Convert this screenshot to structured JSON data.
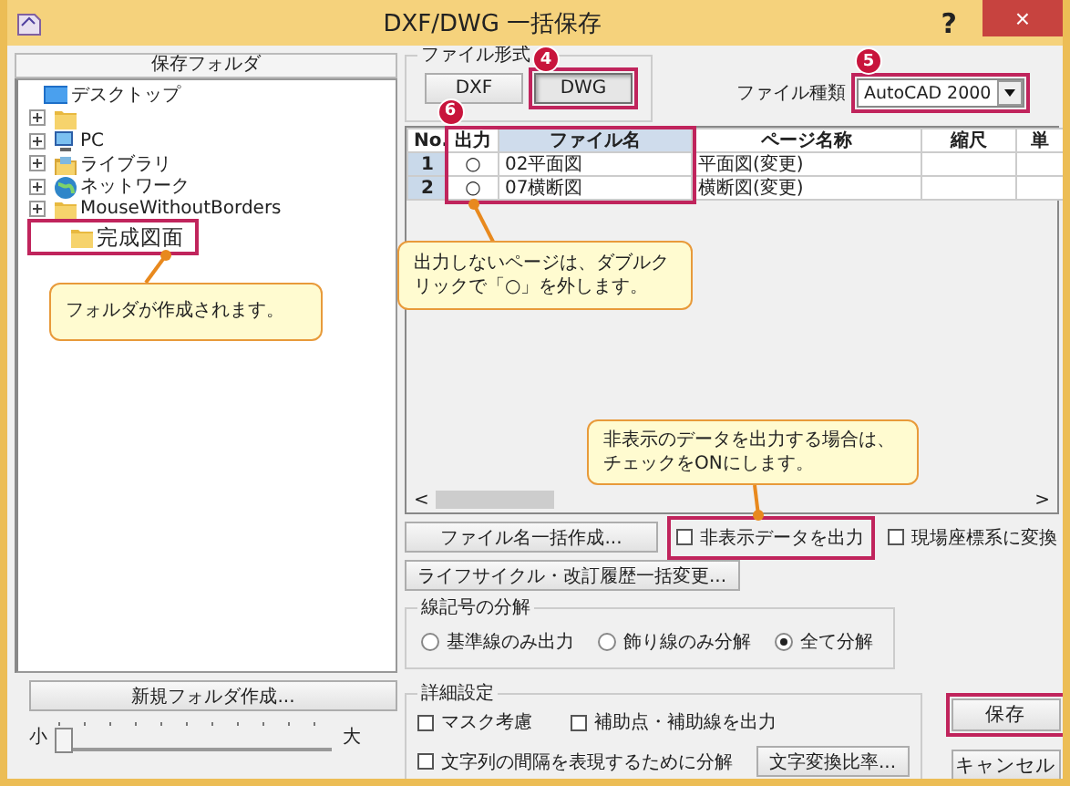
{
  "window": {
    "title": "DXF/DWG 一括保存",
    "help": "?",
    "close": "×"
  },
  "folder_panel": {
    "header": "保存フォルダ",
    "tree": [
      {
        "label": "デスクトップ",
        "expandable": false,
        "children": [
          {
            "expandable": true
          },
          {
            "label": "PC",
            "expandable": true
          },
          {
            "label": "ライブラリ",
            "expandable": true
          },
          {
            "label": "ネットワーク",
            "expandable": true
          },
          {
            "label": "MouseWithoutBorders",
            "expandable": true
          },
          {
            "label": "完成図面",
            "expandable": false
          }
        ]
      }
    ],
    "new_folder_button": "新規フォルダ作成...",
    "size_slider": {
      "min_label": "小",
      "max_label": "大",
      "level": 0
    }
  },
  "file_format": {
    "legend": "ファイル形式",
    "options": [
      {
        "label": "DXF",
        "selected": false
      },
      {
        "label": "DWG",
        "selected": true
      }
    ]
  },
  "file_type": {
    "label": "ファイル種類",
    "value": "AutoCAD 2000"
  },
  "table": {
    "columns": [
      {
        "label": "No.",
        "selected": false
      },
      {
        "label": "出力",
        "selected": false
      },
      {
        "label": "ファイル名",
        "selected": true
      },
      {
        "label": "ページ名称",
        "selected": false
      },
      {
        "label": "縮尺",
        "selected": false
      },
      {
        "label": "単",
        "selected": false
      }
    ],
    "rows": [
      {
        "no": "1",
        "output": "○",
        "file_name": "02平面図",
        "page_name": "平面図(変更)"
      },
      {
        "no": "2",
        "output": "○",
        "file_name": "07横断図",
        "page_name": "横断図(変更)"
      }
    ],
    "scroll_left": "<",
    "scroll_right": ">"
  },
  "buttons": [
    {
      "label": "ファイル名一括作成..."
    },
    {
      "label": "ライフサイクル・改訂履歴一括変更..."
    }
  ],
  "options": [
    {
      "label": "非表示データを出力",
      "checked": false
    },
    {
      "label": "現場座標系に変換",
      "checked": false
    }
  ],
  "line_symbol": {
    "legend": "線記号の分解",
    "choices": [
      {
        "label": "基準線のみ出力",
        "selected": false
      },
      {
        "label": "飾り線のみ分解",
        "selected": false
      },
      {
        "label": "全て分解",
        "selected": true
      }
    ]
  },
  "details": {
    "legend": "詳細設定",
    "checks": [
      {
        "label": "マスク考慮",
        "checked": false
      },
      {
        "label": "補助点・補助線を出力",
        "checked": false
      },
      {
        "label": "文字列の間隔を表現するために分解",
        "checked": false
      }
    ],
    "button": "文字変換比率..."
  },
  "save": "保存",
  "cancel": "キャンセル",
  "badges": [
    "4",
    "5",
    "6"
  ],
  "callouts": [
    "フォルダが作成されます。",
    "出力しないページは、ダブルクリックで「○」を外します。",
    "非表示のデータを出力する場合は、チェックをONにします。"
  ]
}
